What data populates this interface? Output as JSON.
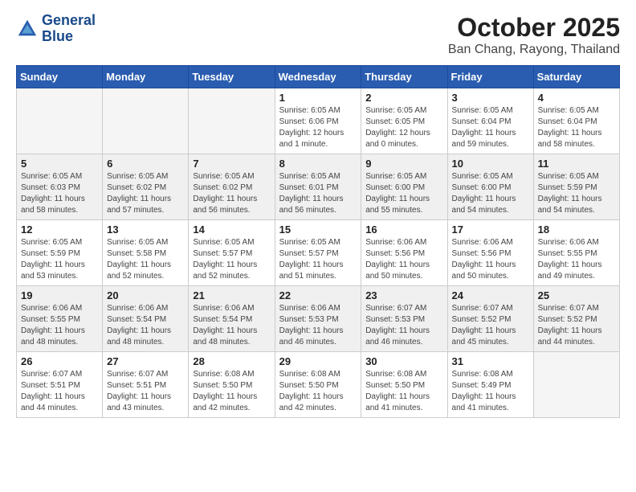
{
  "logo": {
    "line1": "General",
    "line2": "Blue"
  },
  "title": "October 2025",
  "location": "Ban Chang, Rayong, Thailand",
  "weekdays": [
    "Sunday",
    "Monday",
    "Tuesday",
    "Wednesday",
    "Thursday",
    "Friday",
    "Saturday"
  ],
  "weeks": [
    [
      {
        "day": "",
        "info": ""
      },
      {
        "day": "",
        "info": ""
      },
      {
        "day": "",
        "info": ""
      },
      {
        "day": "1",
        "info": "Sunrise: 6:05 AM\nSunset: 6:06 PM\nDaylight: 12 hours\nand 1 minute."
      },
      {
        "day": "2",
        "info": "Sunrise: 6:05 AM\nSunset: 6:05 PM\nDaylight: 12 hours\nand 0 minutes."
      },
      {
        "day": "3",
        "info": "Sunrise: 6:05 AM\nSunset: 6:04 PM\nDaylight: 11 hours\nand 59 minutes."
      },
      {
        "day": "4",
        "info": "Sunrise: 6:05 AM\nSunset: 6:04 PM\nDaylight: 11 hours\nand 58 minutes."
      }
    ],
    [
      {
        "day": "5",
        "info": "Sunrise: 6:05 AM\nSunset: 6:03 PM\nDaylight: 11 hours\nand 58 minutes."
      },
      {
        "day": "6",
        "info": "Sunrise: 6:05 AM\nSunset: 6:02 PM\nDaylight: 11 hours\nand 57 minutes."
      },
      {
        "day": "7",
        "info": "Sunrise: 6:05 AM\nSunset: 6:02 PM\nDaylight: 11 hours\nand 56 minutes."
      },
      {
        "day": "8",
        "info": "Sunrise: 6:05 AM\nSunset: 6:01 PM\nDaylight: 11 hours\nand 56 minutes."
      },
      {
        "day": "9",
        "info": "Sunrise: 6:05 AM\nSunset: 6:00 PM\nDaylight: 11 hours\nand 55 minutes."
      },
      {
        "day": "10",
        "info": "Sunrise: 6:05 AM\nSunset: 6:00 PM\nDaylight: 11 hours\nand 54 minutes."
      },
      {
        "day": "11",
        "info": "Sunrise: 6:05 AM\nSunset: 5:59 PM\nDaylight: 11 hours\nand 54 minutes."
      }
    ],
    [
      {
        "day": "12",
        "info": "Sunrise: 6:05 AM\nSunset: 5:59 PM\nDaylight: 11 hours\nand 53 minutes."
      },
      {
        "day": "13",
        "info": "Sunrise: 6:05 AM\nSunset: 5:58 PM\nDaylight: 11 hours\nand 52 minutes."
      },
      {
        "day": "14",
        "info": "Sunrise: 6:05 AM\nSunset: 5:57 PM\nDaylight: 11 hours\nand 52 minutes."
      },
      {
        "day": "15",
        "info": "Sunrise: 6:05 AM\nSunset: 5:57 PM\nDaylight: 11 hours\nand 51 minutes."
      },
      {
        "day": "16",
        "info": "Sunrise: 6:06 AM\nSunset: 5:56 PM\nDaylight: 11 hours\nand 50 minutes."
      },
      {
        "day": "17",
        "info": "Sunrise: 6:06 AM\nSunset: 5:56 PM\nDaylight: 11 hours\nand 50 minutes."
      },
      {
        "day": "18",
        "info": "Sunrise: 6:06 AM\nSunset: 5:55 PM\nDaylight: 11 hours\nand 49 minutes."
      }
    ],
    [
      {
        "day": "19",
        "info": "Sunrise: 6:06 AM\nSunset: 5:55 PM\nDaylight: 11 hours\nand 48 minutes."
      },
      {
        "day": "20",
        "info": "Sunrise: 6:06 AM\nSunset: 5:54 PM\nDaylight: 11 hours\nand 48 minutes."
      },
      {
        "day": "21",
        "info": "Sunrise: 6:06 AM\nSunset: 5:54 PM\nDaylight: 11 hours\nand 48 minutes."
      },
      {
        "day": "22",
        "info": "Sunrise: 6:06 AM\nSunset: 5:53 PM\nDaylight: 11 hours\nand 46 minutes."
      },
      {
        "day": "23",
        "info": "Sunrise: 6:07 AM\nSunset: 5:53 PM\nDaylight: 11 hours\nand 46 minutes."
      },
      {
        "day": "24",
        "info": "Sunrise: 6:07 AM\nSunset: 5:52 PM\nDaylight: 11 hours\nand 45 minutes."
      },
      {
        "day": "25",
        "info": "Sunrise: 6:07 AM\nSunset: 5:52 PM\nDaylight: 11 hours\nand 44 minutes."
      }
    ],
    [
      {
        "day": "26",
        "info": "Sunrise: 6:07 AM\nSunset: 5:51 PM\nDaylight: 11 hours\nand 44 minutes."
      },
      {
        "day": "27",
        "info": "Sunrise: 6:07 AM\nSunset: 5:51 PM\nDaylight: 11 hours\nand 43 minutes."
      },
      {
        "day": "28",
        "info": "Sunrise: 6:08 AM\nSunset: 5:50 PM\nDaylight: 11 hours\nand 42 minutes."
      },
      {
        "day": "29",
        "info": "Sunrise: 6:08 AM\nSunset: 5:50 PM\nDaylight: 11 hours\nand 42 minutes."
      },
      {
        "day": "30",
        "info": "Sunrise: 6:08 AM\nSunset: 5:50 PM\nDaylight: 11 hours\nand 41 minutes."
      },
      {
        "day": "31",
        "info": "Sunrise: 6:08 AM\nSunset: 5:49 PM\nDaylight: 11 hours\nand 41 minutes."
      },
      {
        "day": "",
        "info": ""
      }
    ]
  ]
}
